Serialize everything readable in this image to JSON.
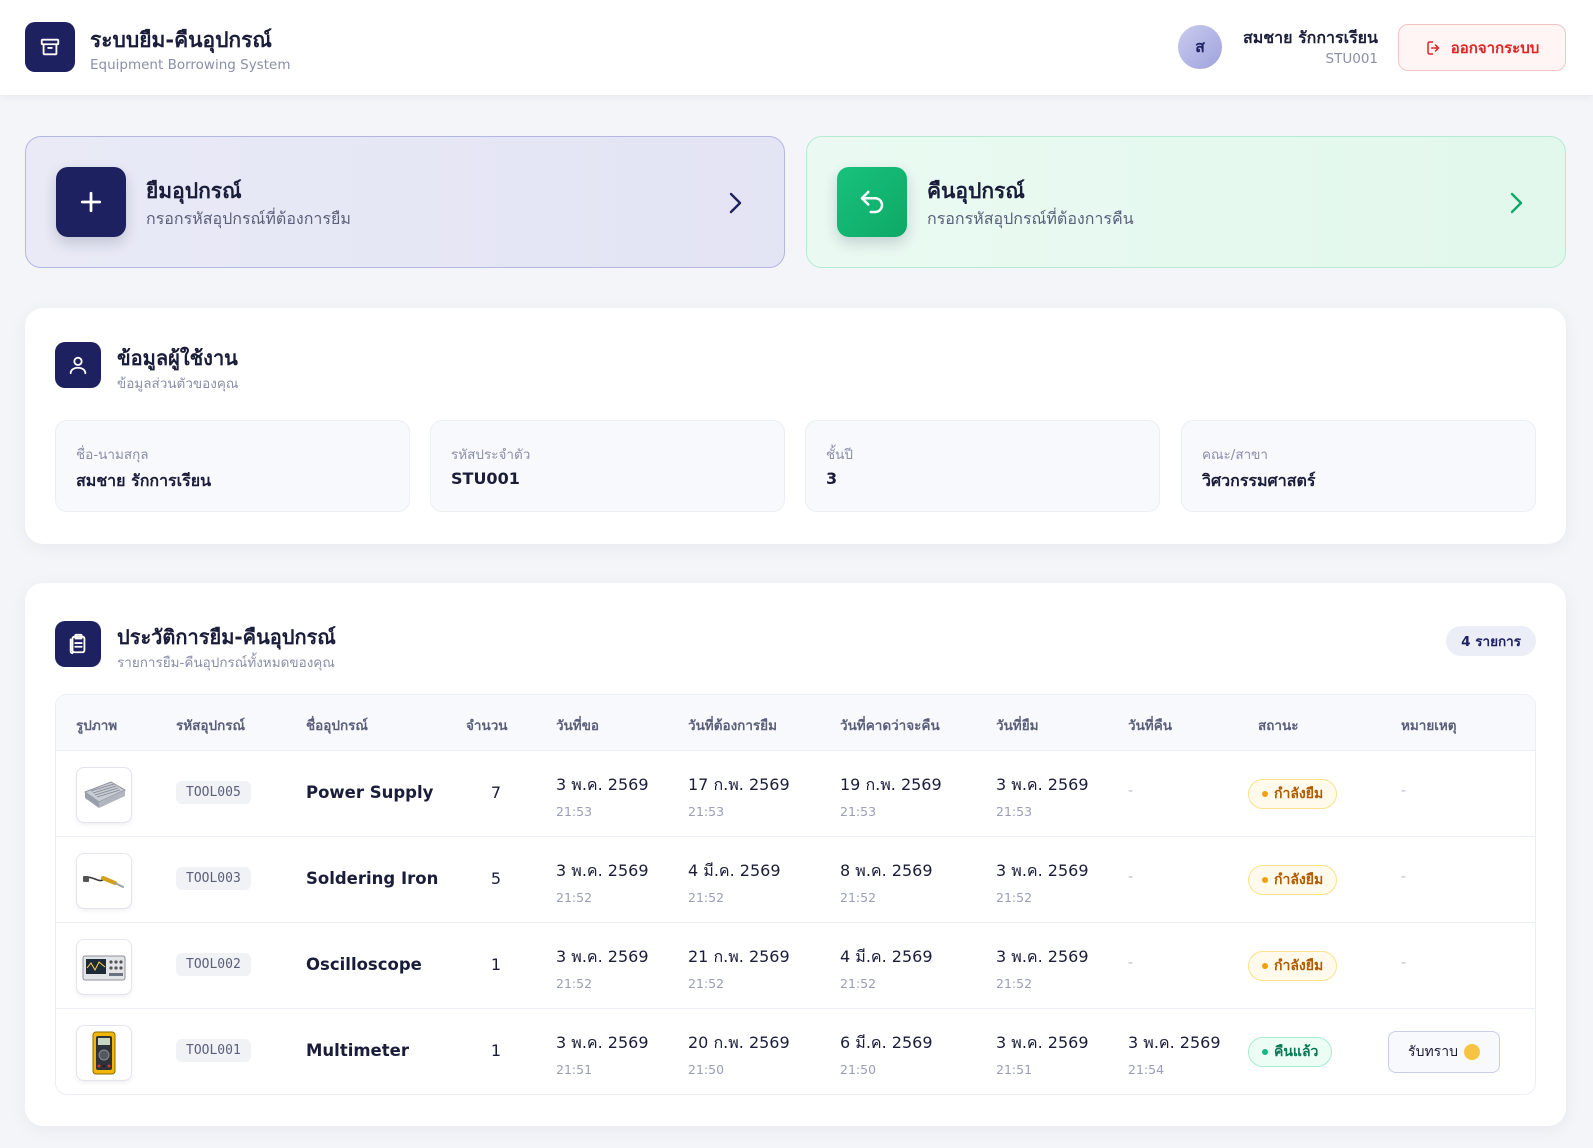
{
  "header": {
    "title": "ระบบยืม-คืนอุปกรณ์",
    "subtitle": "Equipment Borrowing System",
    "avatar_initial": "ส",
    "user_name": "สมชาย รักการเรียน",
    "user_id": "STU001",
    "logout_label": "ออกจากระบบ"
  },
  "actions": {
    "borrow": {
      "title": "ยืมอุปกรณ์",
      "subtitle": "กรอกรหัสอุปกรณ์ที่ต้องการยืม"
    },
    "return": {
      "title": "คืนอุปกรณ์",
      "subtitle": "กรอกรหัสอุปกรณ์ที่ต้องการคืน"
    }
  },
  "user_info": {
    "title": "ข้อมูลผู้ใช้งาน",
    "subtitle": "ข้อมูลส่วนตัวของคุณ",
    "fields": [
      {
        "label": "ชื่อ-นามสกุล",
        "value": "สมชาย รักการเรียน"
      },
      {
        "label": "รหัสประจำตัว",
        "value": "STU001"
      },
      {
        "label": "ชั้นปี",
        "value": "3"
      },
      {
        "label": "คณะ/สาขา",
        "value": "วิศวกรรมศาสตร์"
      }
    ]
  },
  "history": {
    "title": "ประวัติการยืม-คืนอุปกรณ์",
    "subtitle": "รายการยืม-คืนอุปกรณ์ทั้งหมดของคุณ",
    "count_label": "4 รายการ",
    "columns": [
      "รูปภาพ",
      "รหัสอุปกรณ์",
      "ชื่ออุปกรณ์",
      "จำนวน",
      "วันที่ขอ",
      "วันที่ต้องการยืม",
      "วันที่คาดว่าจะคืน",
      "วันที่ยืม",
      "วันที่คืน",
      "สถานะ",
      "หมายเหตุ"
    ],
    "rows": [
      {
        "image": "power-supply-image",
        "code": "TOOL005",
        "name": "Power Supply",
        "qty": "7",
        "requested": {
          "date": "3 พ.ค. 2569",
          "time": "21:53"
        },
        "wanted": {
          "date": "17 ก.พ. 2569",
          "time": "21:53"
        },
        "expected_return": {
          "date": "19 ก.พ. 2569",
          "time": "21:53"
        },
        "borrowed": {
          "date": "3 พ.ค. 2569",
          "time": "21:53"
        },
        "returned": "-",
        "status": "กำลังยืม",
        "note": "-"
      },
      {
        "image": "soldering-iron-image",
        "code": "TOOL003",
        "name": "Soldering Iron",
        "qty": "5",
        "requested": {
          "date": "3 พ.ค. 2569",
          "time": "21:52"
        },
        "wanted": {
          "date": "4 มี.ค. 2569",
          "time": "21:52"
        },
        "expected_return": {
          "date": "8 พ.ค. 2569",
          "time": "21:52"
        },
        "borrowed": {
          "date": "3 พ.ค. 2569",
          "time": "21:52"
        },
        "returned": "-",
        "status": "กำลังยืม",
        "note": "-"
      },
      {
        "image": "oscilloscope-image",
        "code": "TOOL002",
        "name": "Oscilloscope",
        "qty": "1",
        "requested": {
          "date": "3 พ.ค. 2569",
          "time": "21:52"
        },
        "wanted": {
          "date": "21 ก.พ. 2569",
          "time": "21:52"
        },
        "expected_return": {
          "date": "4 มี.ค. 2569",
          "time": "21:52"
        },
        "borrowed": {
          "date": "3 พ.ค. 2569",
          "time": "21:52"
        },
        "returned": "-",
        "status": "กำลังยืม",
        "note": "-"
      },
      {
        "image": "multimeter-image",
        "code": "TOOL001",
        "name": "Multimeter",
        "qty": "1",
        "requested": {
          "date": "3 พ.ค. 2569",
          "time": "21:51"
        },
        "wanted": {
          "date": "20 ก.พ. 2569",
          "time": "21:50"
        },
        "expected_return": {
          "date": "6 มี.ค. 2569",
          "time": "21:50"
        },
        "borrowed": {
          "date": "3 พ.ค. 2569",
          "time": "21:51"
        },
        "returned": {
          "date": "3 พ.ค. 2569",
          "time": "21:54"
        },
        "status": "คืนแล้ว",
        "note_button": "รับทราบ"
      }
    ]
  },
  "colors": {
    "primary": "#1e2160",
    "success": "#10b981",
    "danger": "#e02424",
    "warning": "#f59e0b"
  },
  "icons": {
    "logo": "archive-box-icon",
    "logout": "logout-icon",
    "borrow": "plus-icon",
    "return": "undo-arrow-icon",
    "chevron": "chevron-right-icon",
    "user_panel": "user-icon",
    "history_panel": "clipboard-icon"
  }
}
